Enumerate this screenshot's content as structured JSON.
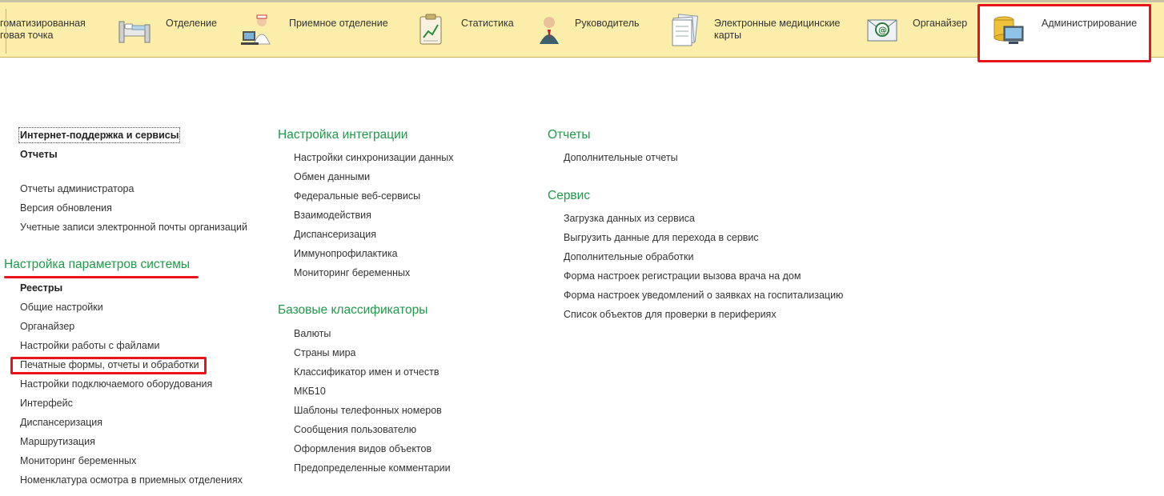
{
  "topbar": {
    "sections": [
      {
        "id": "arm",
        "line1": "гоматизированная",
        "line2": "говая точка",
        "icon": "workstation-icon"
      },
      {
        "id": "department",
        "line1": "Отделение",
        "line2": "",
        "icon": "hospital-bed-icon"
      },
      {
        "id": "reception",
        "line1": "Приемное отделение",
        "line2": "",
        "icon": "nurse-computer-icon"
      },
      {
        "id": "statistics",
        "line1": "Статистика",
        "line2": "",
        "icon": "clipboard-chart-icon"
      },
      {
        "id": "manager",
        "line1": "Руководитель",
        "line2": "",
        "icon": "manager-person-icon"
      },
      {
        "id": "emr",
        "line1": "Электронные медицинские",
        "line2": "карты",
        "icon": "documents-stack-icon"
      },
      {
        "id": "organizer",
        "line1": "Органайзер",
        "line2": "",
        "icon": "mail-envelope-icon"
      },
      {
        "id": "administration",
        "line1": "Администрирование",
        "line2": "",
        "icon": "database-monitor-icon"
      }
    ]
  },
  "col1": {
    "top_items": [
      "Интернет-поддержка и сервисы",
      "Отчеты"
    ],
    "mid_items": [
      "Отчеты администратора",
      "Версия обновления",
      "Учетные записи электронной почты организаций"
    ],
    "system_header": "Настройка параметров системы",
    "registries_label": "Реестры",
    "system_items": [
      "Общие настройки",
      "Органайзер",
      "Настройки работы с файлами",
      "Печатные формы, отчеты и обработки",
      "Настройки подключаемого оборудования",
      "Интерфейс",
      "Диспансеризация",
      "Маршрутизация",
      "Мониторинг беременных",
      "Номенклатура осмотра в приемных отделениях"
    ]
  },
  "col2": {
    "integration_header": "Настройка интеграции",
    "integration_items": [
      "Настройки синхронизации данных",
      "Обмен данными",
      "Федеральные веб-сервисы",
      "Взаимодействия",
      "Диспансеризация",
      "Иммунопрофилактика",
      "Мониторинг беременных"
    ],
    "classifiers_header": "Базовые классификаторы",
    "classifiers_items": [
      "Валюты",
      "Страны мира",
      "Классификатор имен и отчеств",
      "МКБ10",
      "Шаблоны телефонных номеров",
      "Сообщения пользователю",
      "Оформления видов объектов",
      "Предопределенные комментарии"
    ]
  },
  "col3": {
    "reports_header": "Отчеты",
    "reports_items": [
      "Дополнительные отчеты"
    ],
    "service_header": "Сервис",
    "service_items": [
      "Загрузка данных из сервиса",
      "Выгрузить данные для перехода в сервис",
      "Дополнительные обработки",
      "Форма настроек регистрации вызова врача на дом",
      "Форма настроек уведомлений о заявках на госпитализацию",
      "Список объектов для проверки в периферияx"
    ]
  },
  "colors": {
    "topbar_bg": "#fbeeaa",
    "header_green": "#1e9a4a",
    "annotation_red": "#e8141b"
  }
}
